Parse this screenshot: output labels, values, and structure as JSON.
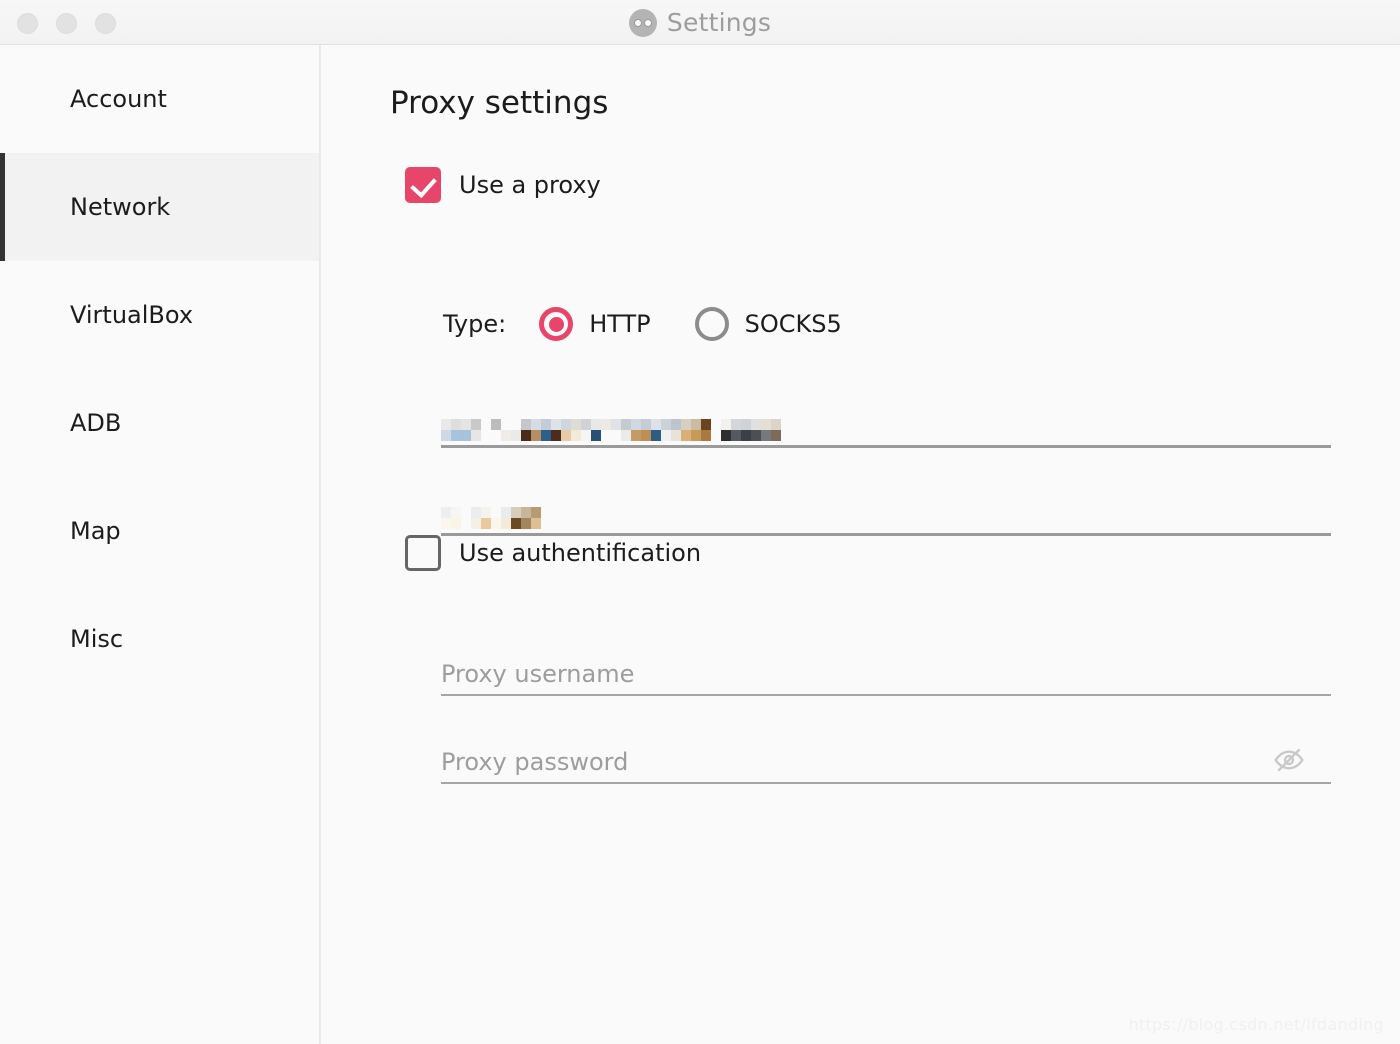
{
  "window": {
    "title": "Settings",
    "app_icon": "binoculars-icon",
    "traffic_lights": [
      "close-button",
      "minimize-button",
      "zoom-button"
    ]
  },
  "sidebar": {
    "items": [
      {
        "label": "Account",
        "selected": false
      },
      {
        "label": "Network",
        "selected": true
      },
      {
        "label": "VirtualBox",
        "selected": false
      },
      {
        "label": "ADB",
        "selected": false
      },
      {
        "label": "Map",
        "selected": false
      },
      {
        "label": "Misc",
        "selected": false
      }
    ]
  },
  "main": {
    "page_title": "Proxy settings",
    "use_proxy": {
      "label": "Use a proxy",
      "checked": true
    },
    "type": {
      "label": "Type:",
      "options": [
        {
          "label": "HTTP",
          "selected": true
        },
        {
          "label": "SOCKS5",
          "selected": false
        }
      ]
    },
    "host_field": {
      "name": "proxy-host",
      "value": "",
      "redacted": true,
      "placeholder": ""
    },
    "port_field": {
      "name": "proxy-port",
      "value": "",
      "redacted": true,
      "placeholder": ""
    },
    "use_authentification": {
      "label": "Use authentification",
      "checked": false
    },
    "username_field": {
      "placeholder": "Proxy username",
      "value": ""
    },
    "password_field": {
      "placeholder": "Proxy password",
      "value": "",
      "reveal_icon": "eye-off-icon"
    }
  },
  "watermark": "https://blog.csdn.net/lfdanding",
  "colors": {
    "accent": "#e8456b",
    "selected_nav_bar": "#333333",
    "selected_nav_bg": "#f2f2f2",
    "text": "#1c1c1c",
    "placeholder": "#9d9d9d",
    "underline": "#9a9a9a",
    "window_bg": "#fafafa"
  }
}
